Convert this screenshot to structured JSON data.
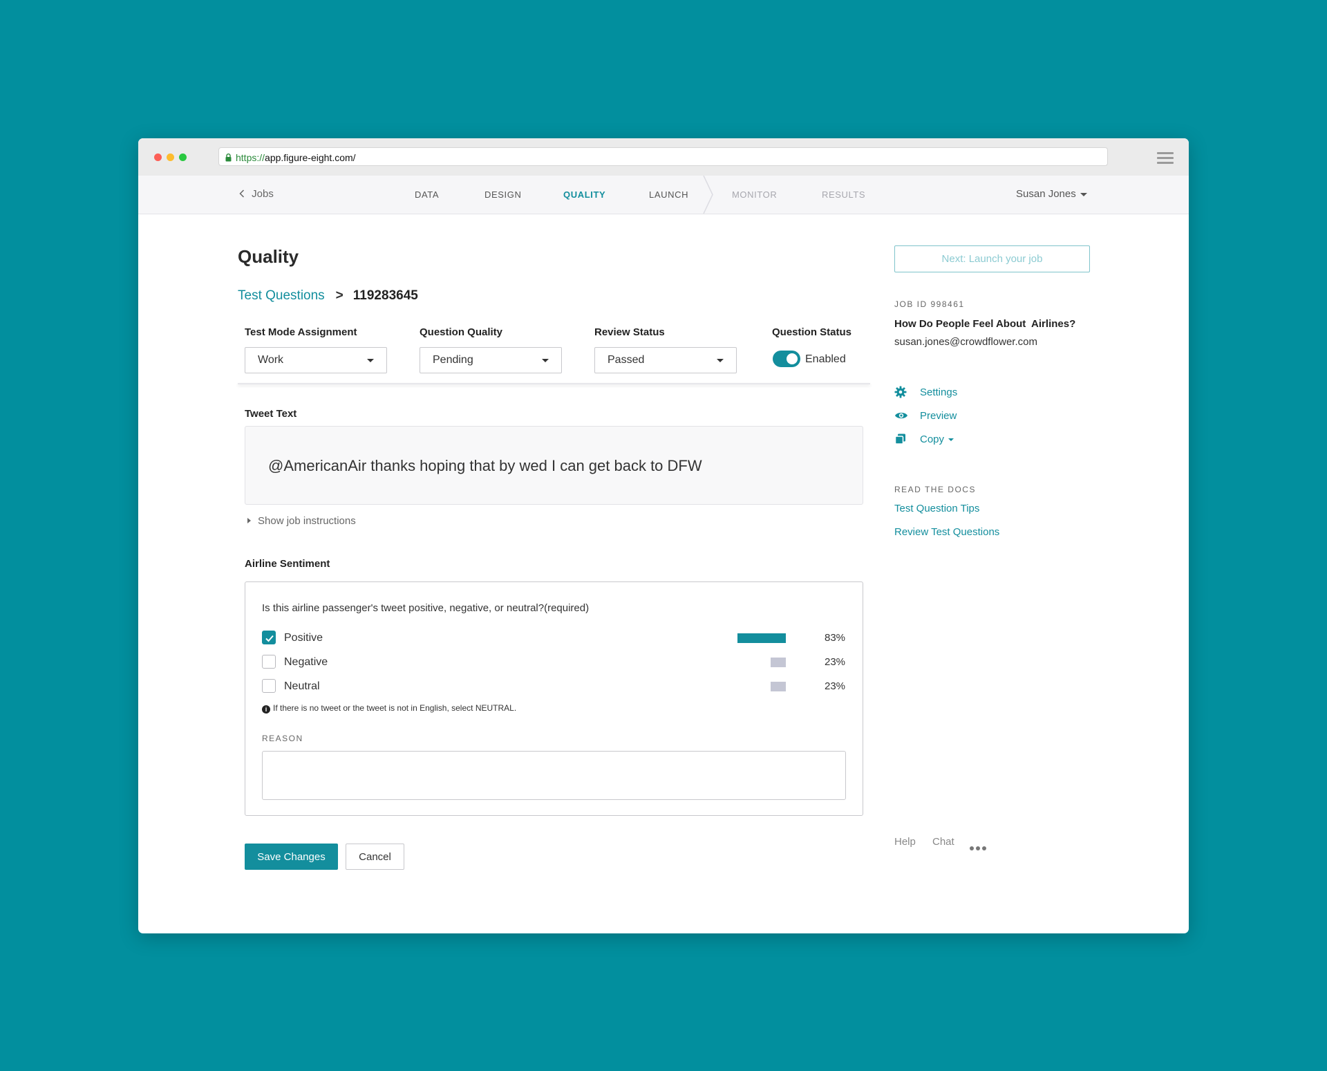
{
  "browser": {
    "url_scheme": "https://",
    "url_host": "app.figure-eight.com/"
  },
  "nav": {
    "back_label": "Jobs",
    "tabs": [
      {
        "label": "DATA",
        "state": "normal"
      },
      {
        "label": "DESIGN",
        "state": "normal"
      },
      {
        "label": "QUALITY",
        "state": "active"
      },
      {
        "label": "LAUNCH",
        "state": "normal"
      },
      {
        "label": "MONITOR",
        "state": "disabled"
      },
      {
        "label": "RESULTS",
        "state": "disabled"
      }
    ],
    "user_name": "Susan Jones"
  },
  "page": {
    "title": "Quality",
    "breadcrumb_link": "Test Questions",
    "breadcrumb_sep": ">",
    "breadcrumb_current": "119283645"
  },
  "fields": {
    "test_mode_label": "Test Mode Assignment",
    "test_mode_value": "Work",
    "question_quality_label": "Question Quality",
    "question_quality_value": "Pending",
    "review_status_label": "Review Status",
    "review_status_value": "Passed",
    "question_status_label": "Question Status",
    "question_status_value": "Enabled",
    "question_status_on": true
  },
  "tweet": {
    "label": "Tweet Text",
    "text": "@AmericanAir thanks hoping that by wed I can get back to DFW",
    "instructions_toggle": "Show job instructions"
  },
  "sentiment": {
    "label": "Airline Sentiment",
    "question": "Is this airline passenger's tweet positive, negative, or neutral?(required)",
    "options": [
      {
        "label": "Positive",
        "checked": true,
        "pct_text": "83%",
        "fraction": 0.83
      },
      {
        "label": "Negative",
        "checked": false,
        "pct_text": "23%",
        "fraction": 0.23
      },
      {
        "label": "Neutral",
        "checked": false,
        "pct_text": "23%",
        "fraction": 0.23
      }
    ],
    "note": "If there is no tweet or the tweet is not in English, select NEUTRAL.",
    "reason_label": "REASON",
    "reason_value": ""
  },
  "actions": {
    "save_label": "Save Changes",
    "cancel_label": "Cancel"
  },
  "sidebar": {
    "next_label": "Next: Launch your job",
    "job_id": "JOB ID 998461",
    "job_title": "How Do People Feel About  Airlines?",
    "job_email": "susan.jones@crowdflower.com",
    "links": [
      {
        "label": "Settings",
        "icon": "gear-icon"
      },
      {
        "label": "Preview",
        "icon": "eye-icon"
      },
      {
        "label": "Copy",
        "icon": "copy-icon"
      }
    ],
    "docs_label": "READ THE DOCS",
    "docs_links": [
      "Test Question Tips",
      "Review Test Questions"
    ],
    "footer": {
      "help": "Help",
      "chat": "Chat"
    }
  },
  "colors": {
    "background": "#028f9e",
    "accent": "#138e9d",
    "bar_positive": "#138e9d",
    "bar_other": "#c4c6d4"
  }
}
